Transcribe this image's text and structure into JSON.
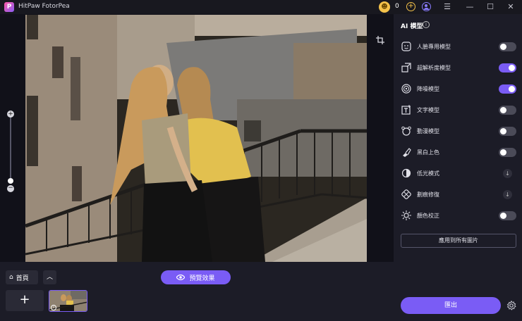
{
  "titlebar": {
    "app_name": "HitPaw FotorPea",
    "coin_count": "0",
    "minimize": "—",
    "maximize": "☐",
    "close": "✕",
    "menu": "☰"
  },
  "bottom": {
    "home_label": "首頁",
    "preview_label": "預覽效果",
    "add_label": "+"
  },
  "panel": {
    "title": "AI 模型",
    "models": [
      {
        "label": "人臉專用模型",
        "icon": "face-icon",
        "state": "off"
      },
      {
        "label": "超解析度模型",
        "icon": "upscale-icon",
        "state": "on"
      },
      {
        "label": "降噪模型",
        "icon": "denoise-icon",
        "state": "on"
      },
      {
        "label": "文字模型",
        "icon": "text-icon",
        "state": "off"
      },
      {
        "label": "動漫模型",
        "icon": "anime-icon",
        "state": "off"
      },
      {
        "label": "黑白上色",
        "icon": "colorize-icon",
        "state": "off"
      },
      {
        "label": "低光模式",
        "icon": "lowlight-icon",
        "state": "download"
      },
      {
        "label": "劃痕修復",
        "icon": "scratch-icon",
        "state": "download"
      },
      {
        "label": "顏色校正",
        "icon": "color-correct-icon",
        "state": "off"
      }
    ],
    "apply_all": "應用到所有圖片",
    "export": "匯出"
  },
  "colors": {
    "accent": "#7a5cf5",
    "background": "#151520",
    "panel": "#1c1c27"
  }
}
